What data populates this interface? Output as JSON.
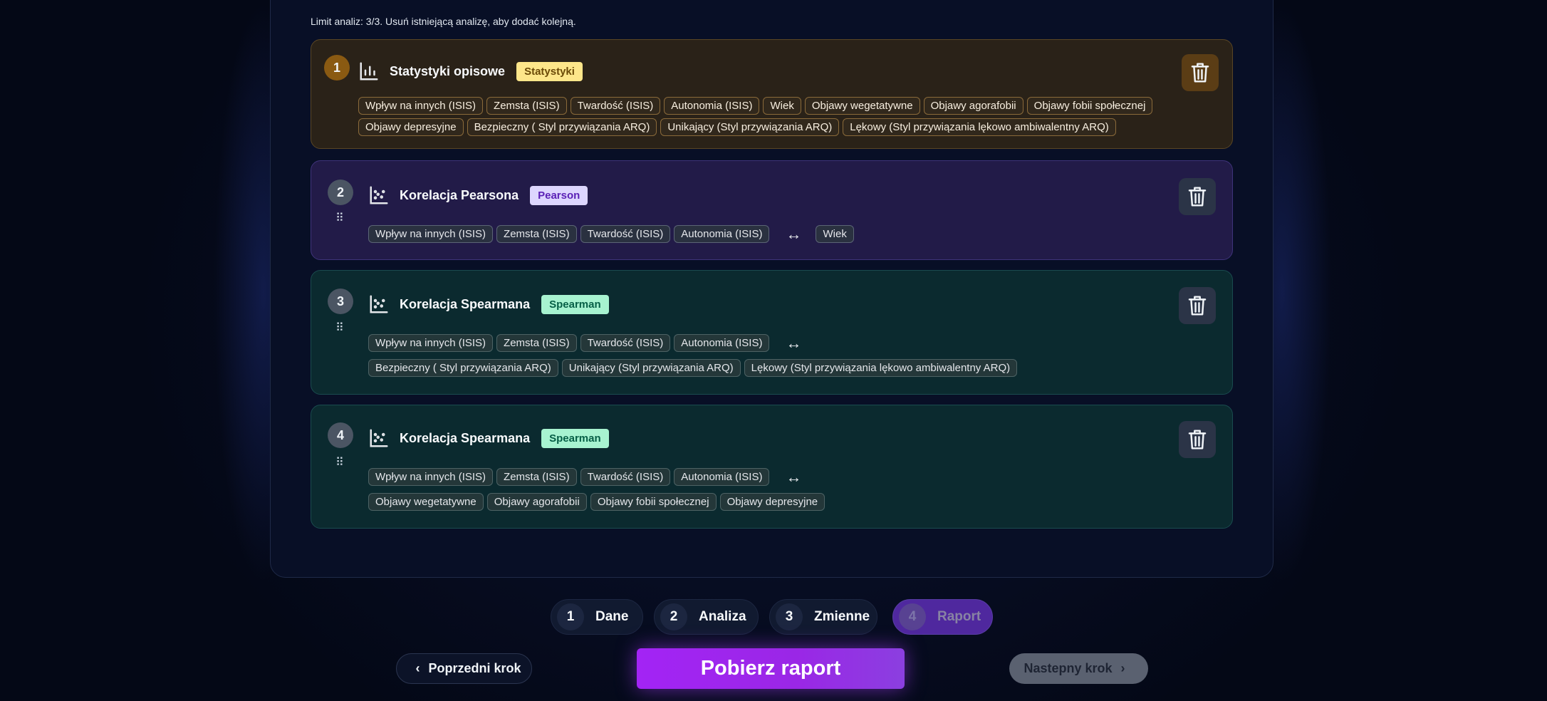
{
  "limit_text": "Limit analiz: 3/3. Usuń istniejącą analizę, aby dodać kolejną.",
  "analyses": [
    {
      "number": "1",
      "title": "Statystyki opisowe",
      "badge": "Statystyki",
      "variables": [
        "Wpływ na innych (ISIS)",
        "Zemsta (ISIS)",
        "Twardość (ISIS)",
        "Autonomia (ISIS)",
        "Wiek",
        "Objawy wegetatywne",
        "Objawy agorafobii",
        "Objawy fobii społecznej",
        "Objawy depresyjne",
        "Bezpieczny ( Styl przywiązania ARQ)",
        "Unikający (Styl przywiązania ARQ)",
        "Lękowy (Styl przywiązania lękowo ambiwalentny ARQ)"
      ]
    },
    {
      "number": "2",
      "title": "Korelacja Pearsona",
      "badge": "Pearson",
      "left_variables": [
        "Wpływ na innych (ISIS)",
        "Zemsta (ISIS)",
        "Twardość (ISIS)",
        "Autonomia (ISIS)"
      ],
      "arrow": "↔",
      "right_variables": [
        "Wiek"
      ]
    },
    {
      "number": "3",
      "title": "Korelacja Spearmana",
      "badge": "Spearman",
      "left_variables": [
        "Wpływ na innych (ISIS)",
        "Zemsta (ISIS)",
        "Twardość (ISIS)",
        "Autonomia (ISIS)"
      ],
      "arrow": "↔",
      "right_variables": [
        "Bezpieczny ( Styl przywiązania ARQ)",
        "Unikający (Styl przywiązania ARQ)",
        "Lękowy (Styl przywiązania lękowo ambiwalentny ARQ)"
      ]
    },
    {
      "number": "4",
      "title": "Korelacja Spearmana",
      "badge": "Spearman",
      "left_variables": [
        "Wpływ na innych (ISIS)",
        "Zemsta (ISIS)",
        "Twardość (ISIS)",
        "Autonomia (ISIS)"
      ],
      "arrow": "↔",
      "right_variables": [
        "Objawy wegetatywne",
        "Objawy agorafobii",
        "Objawy fobii społecznej",
        "Objawy depresyjne"
      ]
    }
  ],
  "steps": [
    {
      "number": "1",
      "label": "Dane"
    },
    {
      "number": "2",
      "label": "Analiza"
    },
    {
      "number": "3",
      "label": "Zmienne"
    },
    {
      "number": "4",
      "label": "Raport"
    }
  ],
  "active_step": "4",
  "buttons": {
    "prev": "Poprzedni krok",
    "main": "Pobierz raport",
    "next": "Nastepny krok"
  },
  "icons": {
    "chevron_left": "‹",
    "chevron_right": "›",
    "drag_handle": "⠿"
  },
  "colors": {
    "accent": "#a324f5",
    "stats_card": "#2a2218",
    "pearson_card": "#221b48",
    "spearman_card": "#0b2a2f"
  }
}
